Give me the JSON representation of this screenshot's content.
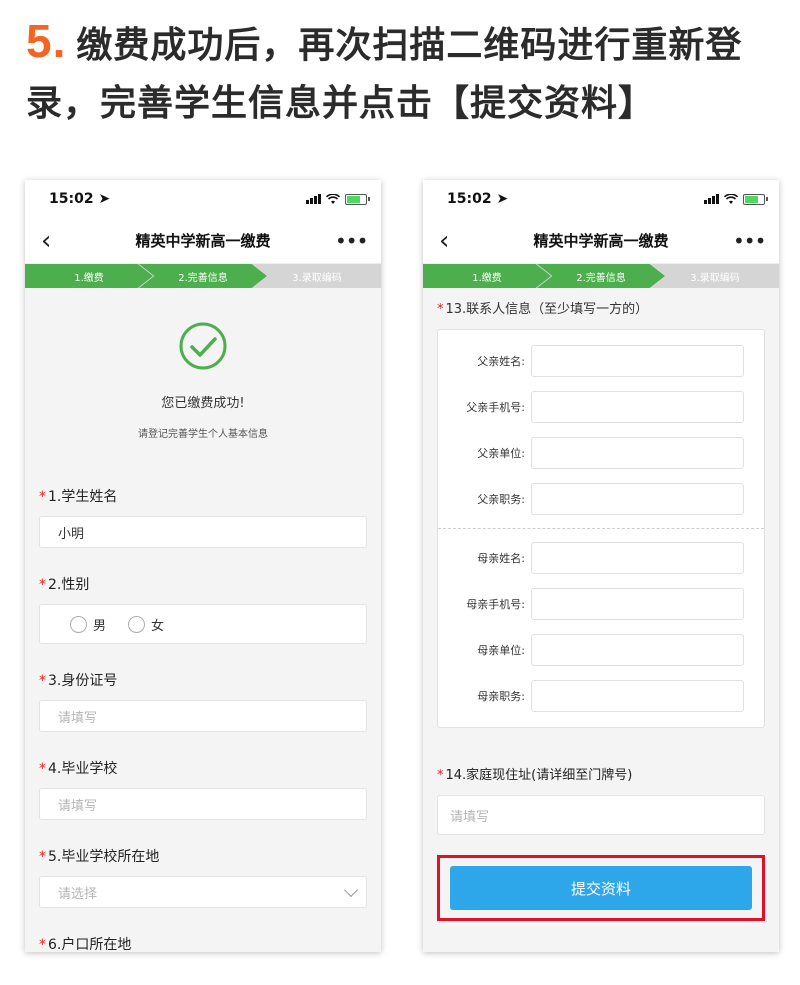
{
  "headline": {
    "number": "5.",
    "text": "缴费成功后，再次扫描二维码进行重新登录，完善学生信息并点击【提交资料】"
  },
  "status": {
    "left_time": "15:02",
    "right_time": "15:02"
  },
  "nav": {
    "title": "精英中学新高一缴费",
    "back_icon": "chevron-left-icon",
    "more_icon": "more-dots-icon"
  },
  "steps": [
    "1.缴费",
    "2.完善信息",
    "3.录取编码"
  ],
  "left": {
    "success_title": "您已缴费成功!",
    "success_sub": "请登记完善学生个人基本信息",
    "fields": {
      "name_label": "1.学生姓名",
      "name_value": "小明",
      "gender_label": "2.性别",
      "gender_male": "男",
      "gender_female": "女",
      "id_label": "3.身份证号",
      "id_placeholder": "请填写",
      "school_label": "4.毕业学校",
      "school_placeholder": "请填写",
      "location_label": "5.毕业学校所在地",
      "location_placeholder": "请选择",
      "hukou_label": "6.户口所在地"
    }
  },
  "right": {
    "q13_label": "13.联系人信息（至少填写一方的）",
    "father": [
      "父亲姓名:",
      "父亲手机号:",
      "父亲单位:",
      "父亲职务:"
    ],
    "mother": [
      "母亲姓名:",
      "母亲手机号:",
      "母亲单位:",
      "母亲职务:"
    ],
    "q14_label": "14.家庭现住址(请详细至门牌号)",
    "q14_placeholder": "请填写",
    "submit_label": "提交资料"
  },
  "colors": {
    "accent_orange": "#f26522",
    "step_green": "#4cae4c",
    "submit_blue": "#2ea6ea",
    "highlight_red": "#e0102a",
    "required_red": "#e02020"
  }
}
